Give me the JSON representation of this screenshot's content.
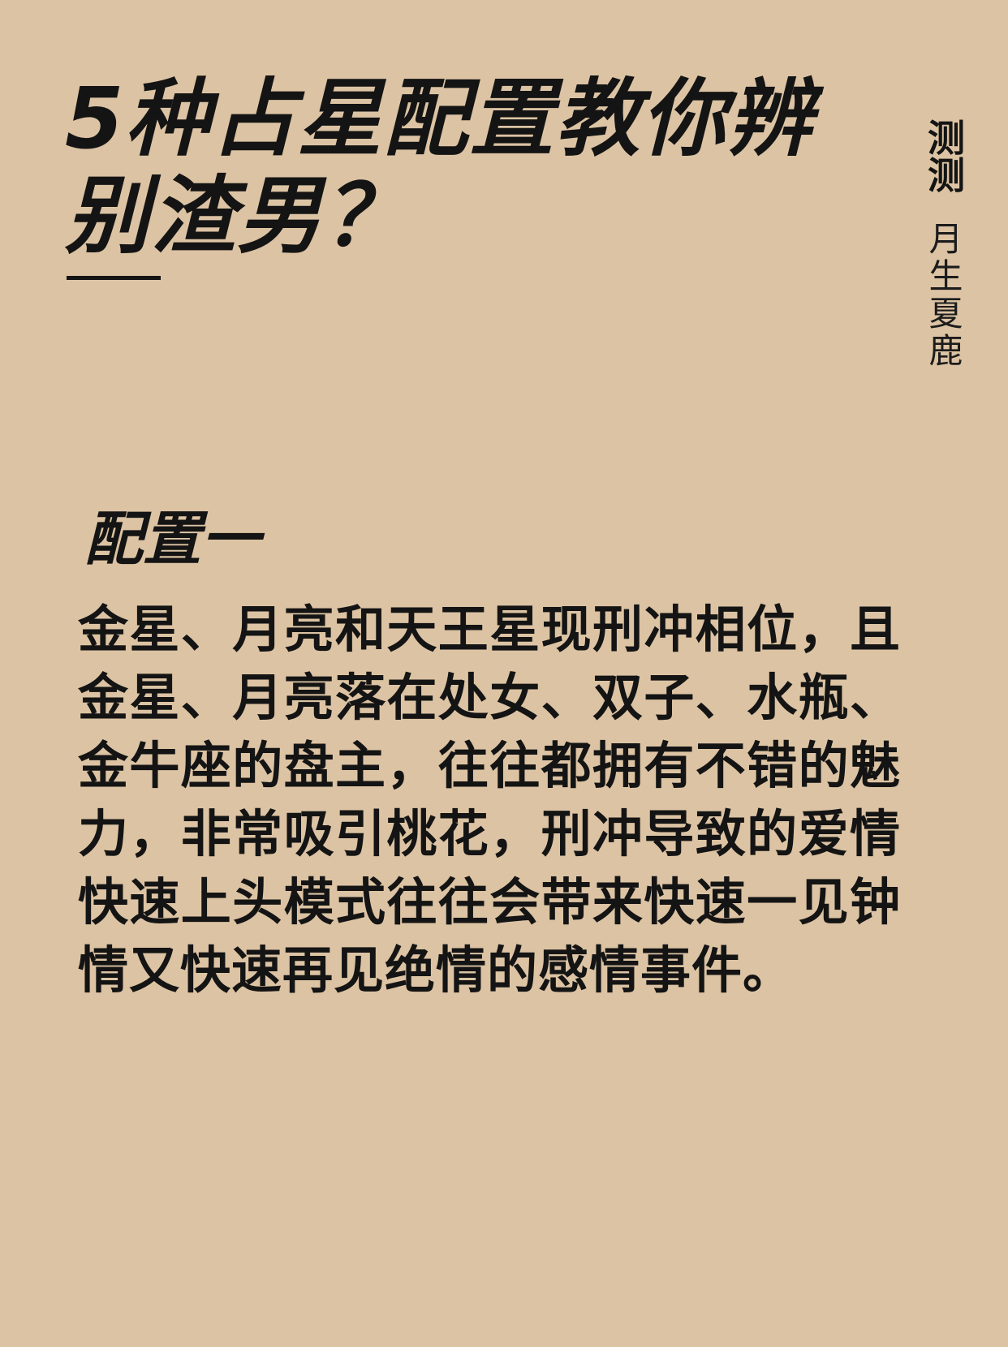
{
  "title": "5种占星配置教你辨别渣男？",
  "side": {
    "tag": "测测",
    "author": "月生夏鹿"
  },
  "section": {
    "heading": "配置一",
    "body": "金星、月亮和天王星现刑冲相位，且金星、月亮落在处女、双子、水瓶、金牛座的盘主，往往都拥有不错的魅力，非常吸引桃花，刑冲导致的爱情快速上头模式往往会带来快速一见钟情又快速再见绝情的感情事件。"
  },
  "colors": {
    "background": "#dcc3a3",
    "text": "#141414"
  }
}
